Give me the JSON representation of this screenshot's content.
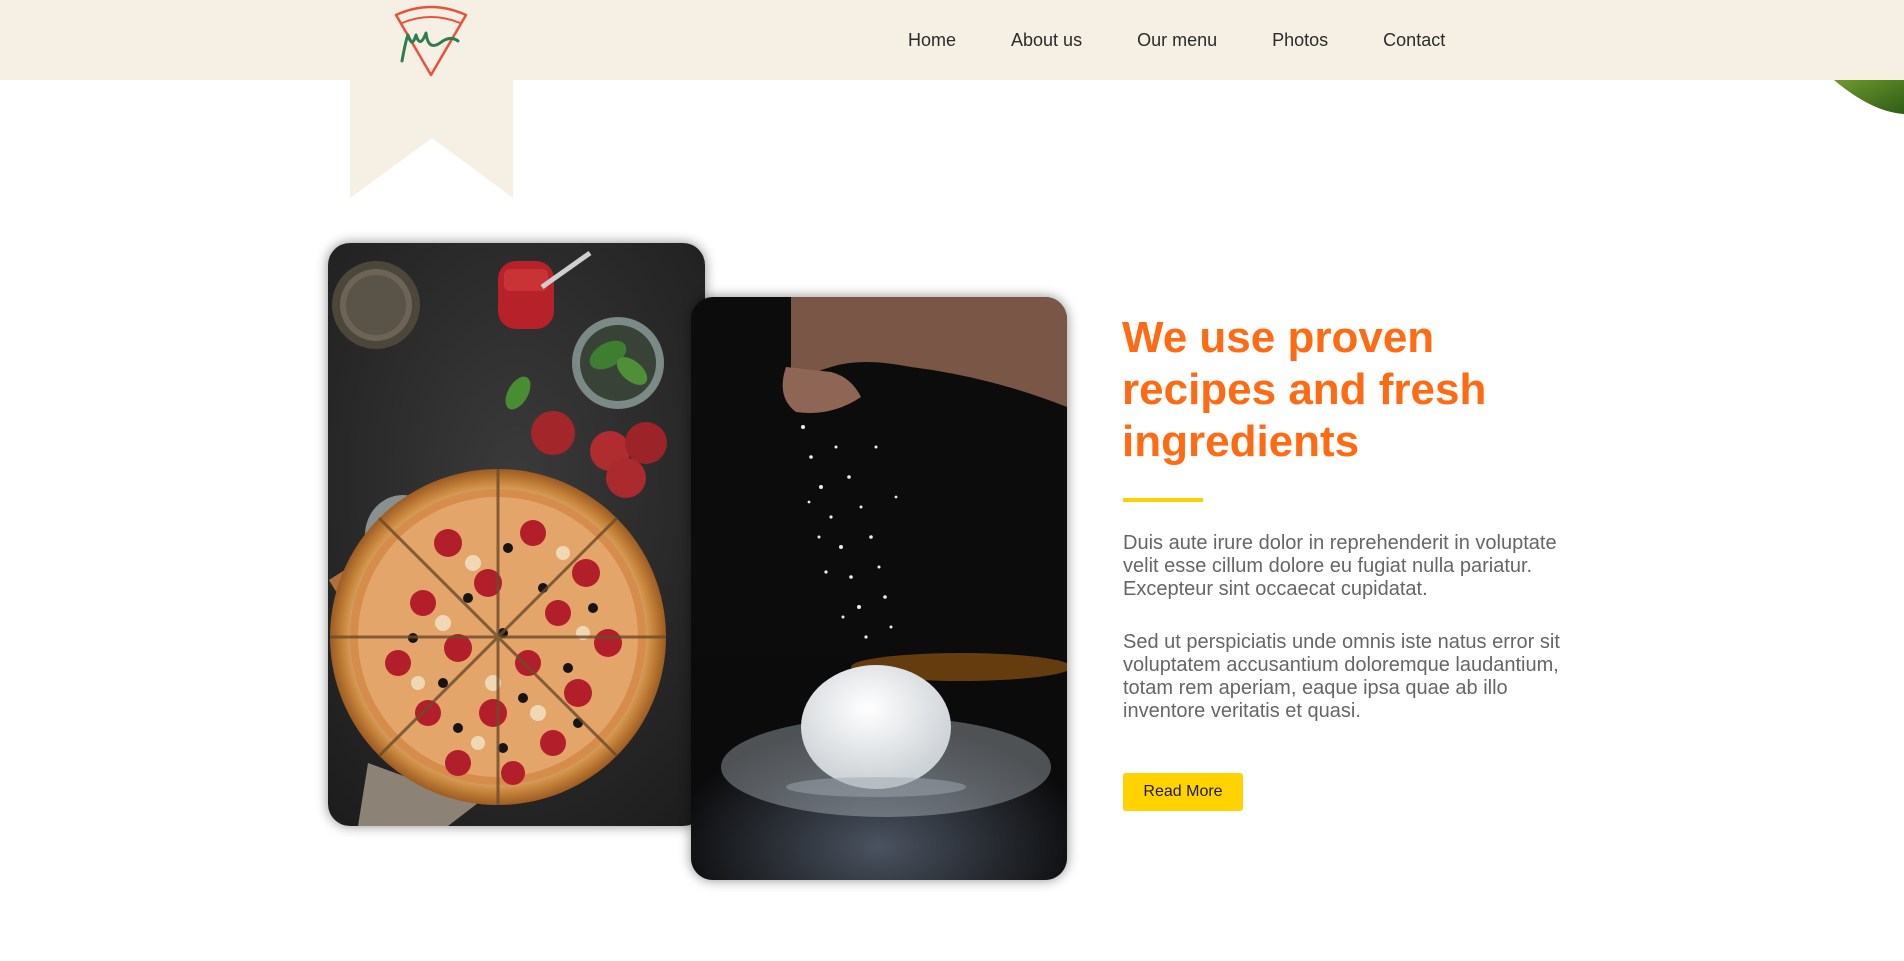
{
  "nav": {
    "items": [
      {
        "label": "Home"
      },
      {
        "label": "About us"
      },
      {
        "label": "Our menu"
      },
      {
        "label": "Photos"
      },
      {
        "label": "Contact"
      }
    ]
  },
  "logo": {
    "icon": "pizza-slice-logo-icon"
  },
  "about": {
    "heading": "We use proven recipes and fresh ingredients",
    "paragraph1": "Duis aute irure dolor in reprehenderit in voluptate velit esse cillum dolore eu fugiat nulla pariatur. Excepteur sint occaecat cupidatat.",
    "paragraph2": "Sed ut perspiciatis unde omnis iste natus error sit voluptatem accusantium doloremque laudantium, totam rem aperiam, eaque ipsa quae ab illo inventore veritatis et quasi.",
    "button_label": "Read More"
  },
  "colors": {
    "header_bg": "#f5efe4",
    "heading": "#ff6a13",
    "accent": "#ffd000",
    "body_text": "#666666",
    "logo_red": "#e8523a",
    "logo_green": "#2e7d4f"
  }
}
